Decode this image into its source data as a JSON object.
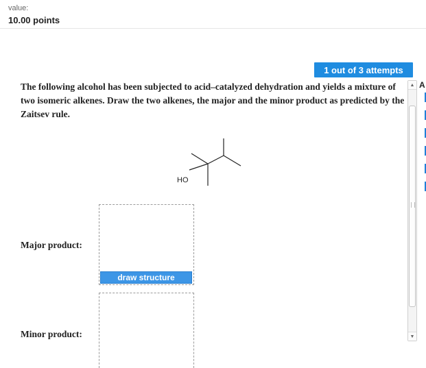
{
  "header": {
    "value_label": "value:",
    "points": "10.00 points"
  },
  "attempts": {
    "label": "1 out of 3 attempts"
  },
  "question": {
    "text": "The following alcohol has been subjected to acid–catalyzed dehydration and yields a mixture of two isomeric alkenes. Draw the two alkenes, the major and the minor product as predicted by the Zaitsev rule."
  },
  "molecule": {
    "oh_label": "HO"
  },
  "answers": {
    "major_label": "Major product:",
    "minor_label": "Minor product:",
    "draw_button": "draw structure"
  },
  "side": {
    "cutoff_letter": "A",
    "scroll_up": "▲",
    "scroll_down": "▼"
  },
  "colors": {
    "accent": "#1f8ce0",
    "button": "#3d96e6"
  }
}
